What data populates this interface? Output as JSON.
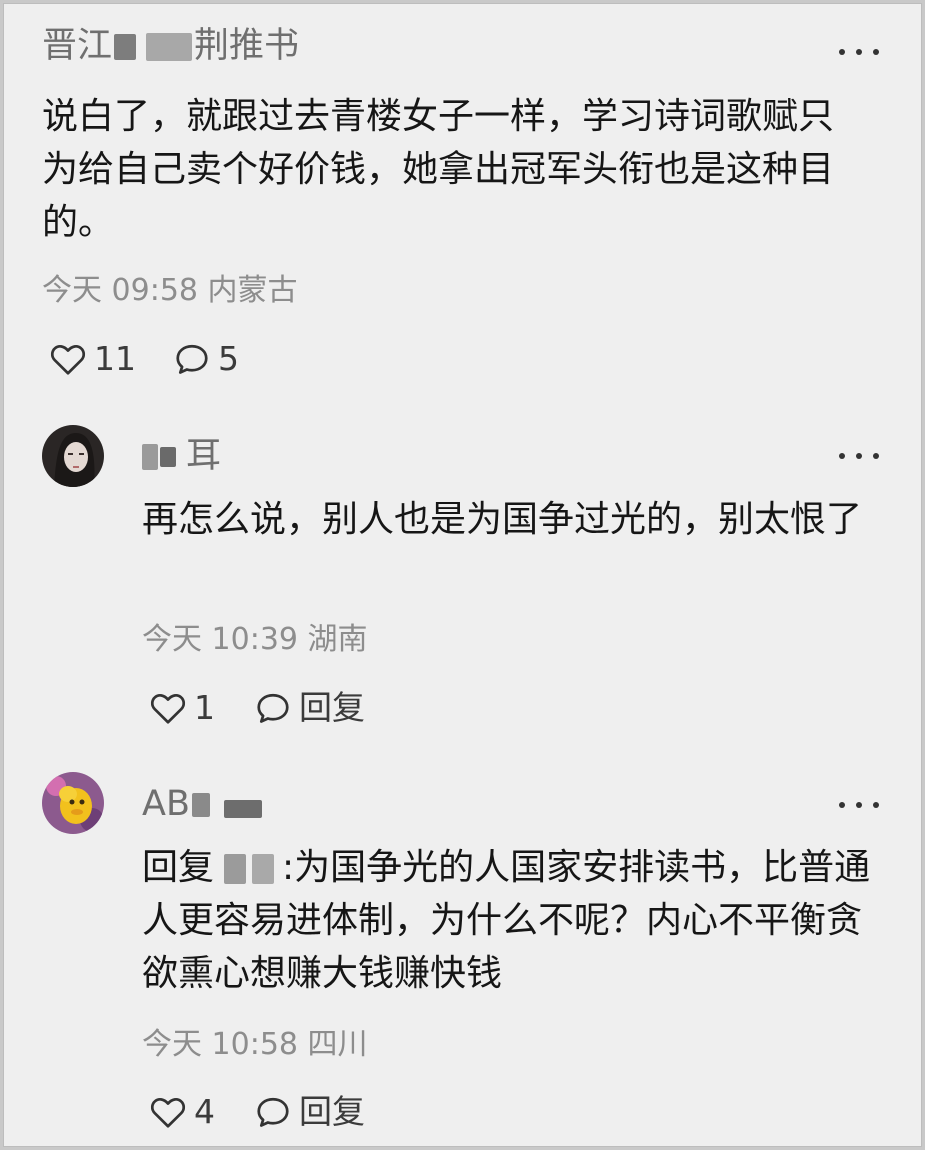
{
  "comments": [
    {
      "user_prefix": "晋江",
      "user_suffix": "荆推书",
      "text": "说白了，就跟过去青楼女子一样，学习诗词歌赋只为给自己卖个好价钱，她拿出冠军头衔也是这种目的。",
      "time": "今天 09:58",
      "location": "内蒙古",
      "like_count": "11",
      "reply_count": "5"
    },
    {
      "user_prefix": "",
      "user_suffix": "耳",
      "text": "再怎么说，别人也是为国争过光的，别太恨了",
      "time": "今天 10:39",
      "location": "湖南",
      "like_count": "1",
      "reply_label": "回复"
    },
    {
      "user_prefix": "AB",
      "user_suffix": "",
      "reply_prefix": "回复",
      "text": "为国争光的人国家安排读书，比普通人更容易进体制，为什么不呢？内心不平衡贪欲熏心想赚大钱赚快钱",
      "time": "今天 10:58",
      "location": "四川",
      "like_count": "4",
      "reply_label": "回复"
    }
  ],
  "icons": {
    "like": "heart-outline-icon",
    "comment": "speech-bubble-icon",
    "more": "more-dots-icon"
  },
  "colors": {
    "background": "#efefef",
    "text": "#161616",
    "muted": "#8d8d8d",
    "username": "#6f6f6f"
  }
}
